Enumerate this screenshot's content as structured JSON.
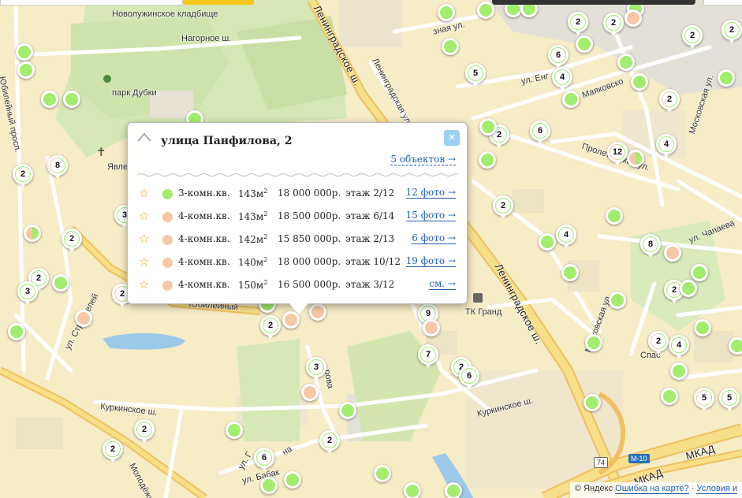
{
  "map": {
    "labels": {
      "cemetery": "Новолужинское кладбище",
      "nagornoe": "Нагорное ш.",
      "park": "парк Дубки",
      "leningradskoe_sh_top": "Ленинградское ш.",
      "leningradskaya_ul": "Ленинградская ул.",
      "zvezdnaya": "зная ул.",
      "ul_eng": "ул. Енг",
      "mayakovsko": "ул. Маяковско",
      "moskovskaya_ul": "Московская ул.",
      "proletarskaya": "Пролетарская ул.",
      "chapaeva": "ул. Чапаева",
      "leningradskoe_sh_main": "Ленинградское ш.",
      "tk_grand": "ТК Гранд",
      "moskovskaya_ul2": "Московская ул.",
      "spas": "Спас",
      "kurkinskoe_left": "Куркинское ш.",
      "kurkinskoe_right": "Куркинское ш.",
      "ul_babak": "ул. Бабак",
      "ul_f": "ул. Г",
      "na": "на",
      "molodezh": "Молодёжн",
      "ul_stroitelei": "ул. Строителей",
      "yubileiny": "Юбилейный",
      "yubileiny_prosp": "Юбилейный просп.",
      "mkad1": "МКАД",
      "mkad2": "МКАД",
      "yavlenskaya": "Явленская це",
      "vo": "рова",
      "m10": "М-10",
      "route74": "74"
    },
    "markers": [
      {
        "label": "",
        "style": "g"
      },
      {
        "label": "",
        "style": "g"
      },
      {
        "label": "",
        "style": "g"
      },
      {
        "label": "",
        "style": "g"
      },
      {
        "label": "8",
        "style": "pg"
      },
      {
        "label": "2",
        "style": "g"
      },
      {
        "label": "",
        "style": "g"
      },
      {
        "label": "",
        "style": "pg"
      },
      {
        "label": "2",
        "style": "g"
      },
      {
        "label": "2",
        "style": "g"
      },
      {
        "label": "3",
        "style": "g"
      },
      {
        "label": "",
        "style": "g"
      },
      {
        "label": "",
        "style": "g"
      },
      {
        "label": "",
        "style": "p"
      },
      {
        "label": "2",
        "style": "pg"
      },
      {
        "label": "3",
        "style": "g"
      },
      {
        "label": "",
        "style": "g"
      },
      {
        "label": "",
        "style": "g"
      },
      {
        "label": "5",
        "style": "g"
      },
      {
        "label": "",
        "style": "g"
      },
      {
        "label": "",
        "style": "g"
      },
      {
        "label": "",
        "style": "g"
      },
      {
        "label": "2",
        "style": "g"
      },
      {
        "label": "6",
        "style": "g"
      },
      {
        "label": "2",
        "style": "g"
      },
      {
        "label": "4",
        "style": "g"
      },
      {
        "label": "",
        "style": "g"
      },
      {
        "label": "",
        "style": "g"
      },
      {
        "label": "2",
        "style": "g"
      },
      {
        "label": "",
        "style": "p"
      },
      {
        "label": "2",
        "style": "g"
      },
      {
        "label": "",
        "style": "g"
      },
      {
        "label": "",
        "style": "g"
      },
      {
        "label": "",
        "style": "g"
      },
      {
        "label": "6",
        "style": "g"
      },
      {
        "label": "2",
        "style": "g"
      },
      {
        "label": "",
        "style": "g"
      },
      {
        "label": "2",
        "style": "pg"
      },
      {
        "label": "",
        "style": "pg"
      },
      {
        "label": "4",
        "style": "g"
      },
      {
        "label": "",
        "style": "g"
      },
      {
        "label": "12",
        "style": "pg"
      },
      {
        "label": "2",
        "style": "g"
      },
      {
        "label": "",
        "style": "g"
      },
      {
        "label": "",
        "style": "g"
      },
      {
        "label": "4",
        "style": "g"
      },
      {
        "label": "8",
        "style": "g"
      },
      {
        "label": "",
        "style": "p"
      },
      {
        "label": "",
        "style": "g"
      },
      {
        "label": "",
        "style": "g"
      },
      {
        "label": "2",
        "style": "g"
      },
      {
        "label": "",
        "style": "g"
      },
      {
        "label": "",
        "style": "g"
      },
      {
        "label": "2",
        "style": "pg"
      },
      {
        "label": "4",
        "style": "g"
      },
      {
        "label": "",
        "style": "g"
      },
      {
        "label": "",
        "style": "g"
      },
      {
        "label": "",
        "style": "g"
      },
      {
        "label": "",
        "style": "g"
      },
      {
        "label": "5",
        "style": "pg"
      },
      {
        "label": "5",
        "style": "g"
      },
      {
        "label": "",
        "style": "p"
      },
      {
        "label": "",
        "style": "p"
      },
      {
        "label": "",
        "style": "g"
      },
      {
        "label": "2",
        "style": "g"
      },
      {
        "label": "9",
        "style": "g"
      },
      {
        "label": "3",
        "style": "g"
      },
      {
        "label": "",
        "style": "p"
      },
      {
        "label": "7",
        "style": "g"
      },
      {
        "label": "2",
        "style": "g"
      },
      {
        "label": "6",
        "style": "g"
      },
      {
        "label": "",
        "style": "p"
      },
      {
        "label": "",
        "style": "g"
      },
      {
        "label": "2",
        "style": "g"
      },
      {
        "label": "2",
        "style": "g"
      },
      {
        "label": "",
        "style": "g"
      },
      {
        "label": "6",
        "style": "g"
      },
      {
        "label": "",
        "style": "g"
      },
      {
        "label": "2",
        "style": "g"
      },
      {
        "label": "",
        "style": "g"
      },
      {
        "label": "",
        "style": "g"
      },
      {
        "label": "",
        "style": "g"
      },
      {
        "label": "",
        "style": "g"
      },
      {
        "label": "",
        "style": "g"
      },
      {
        "label": "",
        "style": "g"
      },
      {
        "label": "",
        "style": "g"
      }
    ]
  },
  "popup": {
    "title": "улица Панфилова, 2",
    "close": "×",
    "count_link": "5 объектов →",
    "rows": [
      {
        "dot": "#a2ec6e",
        "type": "3-комн.кв.",
        "area": "143м",
        "area_sup": "2",
        "price": "18 000 000р.",
        "floor": "этаж 2/12",
        "photos": "12 фото →"
      },
      {
        "dot": "#f8c8a6",
        "type": "4-комн.кв.",
        "area": "143м",
        "area_sup": "2",
        "price": "18 500 000р.",
        "floor": "этаж 6/14",
        "photos": "15 фото →"
      },
      {
        "dot": "#f8c8a6",
        "type": "4-комн.кв.",
        "area": "142м",
        "area_sup": "2",
        "price": "15 850 000р.",
        "floor": "этаж 2/13",
        "photos": "6 фото →"
      },
      {
        "dot": "#f8c8a6",
        "type": "4-комн.кв.",
        "area": "140м",
        "area_sup": "2",
        "price": "18 000 000р.",
        "floor": "этаж 10/12",
        "photos": "19 фото →"
      },
      {
        "dot": "#f8c8a6",
        "type": "4-комн.кв.",
        "area": "150м",
        "area_sup": "2",
        "price": "16 500 000р.",
        "floor": "этаж 3/12",
        "photos": "см. →"
      }
    ]
  },
  "copyright": {
    "yandex": "© Яндекс",
    "error_link": "Ошибка на карте?",
    "terms": "Условия и"
  },
  "colors": {
    "green": "#a2ec6e",
    "peach": "#f8c8a6",
    "link": "#1f5fb0",
    "star": "#e8a317"
  }
}
